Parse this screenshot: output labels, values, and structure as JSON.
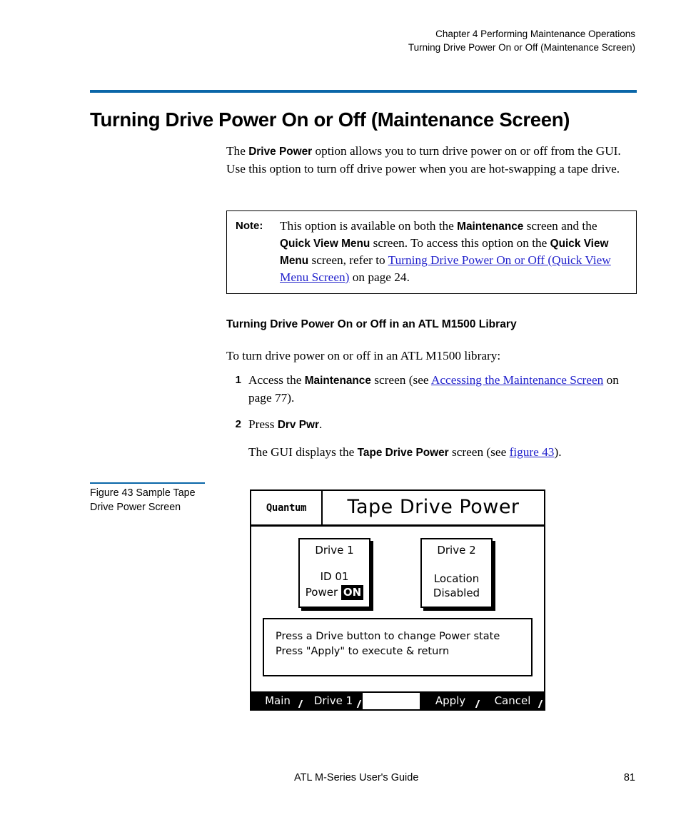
{
  "header": {
    "line1": "Chapter 4  Performing Maintenance Operations",
    "line2": "Turning Drive Power On or Off (Maintenance Screen)"
  },
  "title": "Turning Drive Power On or Off (Maintenance Screen)",
  "intro": {
    "t1": "The ",
    "b1": "Drive Power",
    "t2": " option allows you to turn drive power on or off from the GUI. Use this option to turn off drive power when you are hot-swapping a tape drive."
  },
  "note": {
    "label": "Note:",
    "t1": "This option is available on both the ",
    "b1": "Maintenance",
    "t2": " screen and the ",
    "b2": "Quick View Menu",
    "t3": " screen. To access this option on the ",
    "b3": "Quick View Menu",
    "t4": " screen, refer to ",
    "link": "Turning Drive Power On or Off (Quick View Menu Screen)",
    "t5": " on page 24."
  },
  "subheading": "Turning Drive Power On or Off in an ATL M1500 Library",
  "lead_in": "To turn drive power on or off in an ATL M1500 library:",
  "steps": [
    {
      "num": "1",
      "t1": "Access the ",
      "b1": "Maintenance",
      "t2": " screen (see ",
      "link": "Accessing the Maintenance Screen",
      "t3": " on page 77)."
    },
    {
      "num": "2",
      "t1": "Press ",
      "b1": "Drv Pwr",
      "t2": "."
    }
  ],
  "step_continuation": {
    "t1": "The GUI displays the ",
    "b1": "Tape Drive Power",
    "t2": " screen (see ",
    "link": "figure 43",
    "t3": ")."
  },
  "figure_caption": "Figure 43  Sample Tape Drive Power Screen",
  "gui": {
    "logo": "Quantum",
    "title": "Tape Drive Power",
    "drive1": {
      "title": "Drive 1",
      "line1": "ID 01",
      "power_label": "Power",
      "power_value": "ON"
    },
    "drive2": {
      "title": "Drive 2",
      "line1": "Location",
      "line2": "Disabled"
    },
    "message_line1": "Press a Drive button to change Power state",
    "message_line2": "Press \"Apply\" to execute & return",
    "buttons": [
      {
        "label": "Main"
      },
      {
        "label": "Drive 1"
      },
      {
        "label": ""
      },
      {
        "label": "Apply"
      },
      {
        "label": "Cancel"
      }
    ]
  },
  "footer": {
    "guide": "ATL M-Series User's Guide",
    "page": "81"
  },
  "colors": {
    "rule_blue": "#0a66a8",
    "link_blue": "#2222cc"
  }
}
